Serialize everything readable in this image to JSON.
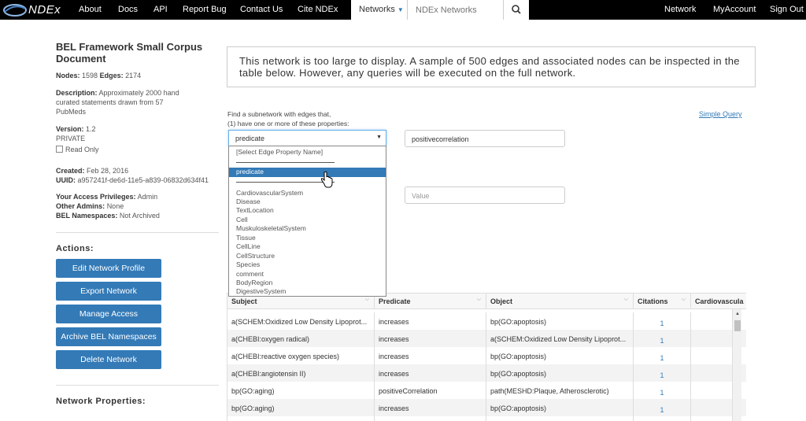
{
  "nav": {
    "brand": "NDEx",
    "links": [
      "About",
      "Docs",
      "API",
      "Report Bug",
      "Contact Us",
      "Cite NDEx"
    ],
    "networks_label": "Networks",
    "search_placeholder": "NDEx Networks",
    "right_links": [
      "Network",
      "MyAccount",
      "Sign Out"
    ]
  },
  "network": {
    "title": "BEL Framework Small Corpus Document",
    "nodes_label": "Nodes:",
    "nodes": "1598",
    "edges_label": "Edges:",
    "edges": "2174",
    "description_label": "Description:",
    "description": "Approximately 2000 hand curated statements drawn from 57 PubMeds",
    "version_label": "Version:",
    "version": "1.2",
    "visibility": "PRIVATE",
    "read_only_label": "Read Only",
    "created_label": "Created:",
    "created": "Feb 28, 2016",
    "uuid_label": "UUID:",
    "uuid": "a957241f-de6d-11e5-a839-06832d634f41",
    "privileges_label": "Your Access Privileges:",
    "privileges": "Admin",
    "other_admins_label": "Other Admins:",
    "other_admins": "None",
    "bel_ns_label": "BEL Namespaces:",
    "bel_ns": "Not Archived"
  },
  "actions": {
    "heading": "Actions:",
    "buttons": [
      "Edit Network Profile",
      "Export Network",
      "Manage Access",
      "Archive BEL Namespaces",
      "Delete Network"
    ],
    "properties_heading": "Network Properties:"
  },
  "notice": "This network is too large to display. A sample of 500 edges and associated nodes can be inspected in the table below. However, any queries will be executed on the full network.",
  "query": {
    "intro_line1": "Find a subnetwork with edges that,",
    "intro_line2": "(1) have one or more of these properties:",
    "simple_query": "Simple Query",
    "selected_property": "predicate",
    "value1": "positivecorrelation",
    "value2_placeholder": "Value",
    "dropdown_header": "[Select Edge Property Name]",
    "dropdown_selected": "predicate",
    "dropdown_options": [
      "CardiovascularSystem",
      "Disease",
      "TextLocation",
      "Cell",
      "MuskuloskeletalSystem",
      "Tissue",
      "CellLine",
      "CellStructure",
      "Species",
      "comment",
      "BodyRegion",
      "DigestiveSystem"
    ]
  },
  "table": {
    "headers": [
      "Subject",
      "Predicate",
      "Object",
      "Citations",
      "Cardiovascula"
    ],
    "rows": [
      [
        "a(SCHEM:Oxidized Low Density Lipoprot...",
        "increases",
        "bp(GO:apoptosis)",
        "1"
      ],
      [
        "a(CHEBI:oxygen radical)",
        "increases",
        "a(SCHEM:Oxidized Low Density Lipoprot...",
        "1"
      ],
      [
        "a(CHEBI:reactive oxygen species)",
        "increases",
        "bp(GO:apoptosis)",
        "1"
      ],
      [
        "a(CHEBI:angiotensin II)",
        "increases",
        "bp(GO:apoptosis)",
        "1"
      ],
      [
        "bp(GO:aging)",
        "positiveCorrelation",
        "path(MESHD:Plaque, Atherosclerotic)",
        "1"
      ],
      [
        "bp(GO:aging)",
        "increases",
        "bp(GO:apoptosis)",
        "1"
      ],
      [
        "",
        "",
        "",
        ""
      ]
    ]
  }
}
